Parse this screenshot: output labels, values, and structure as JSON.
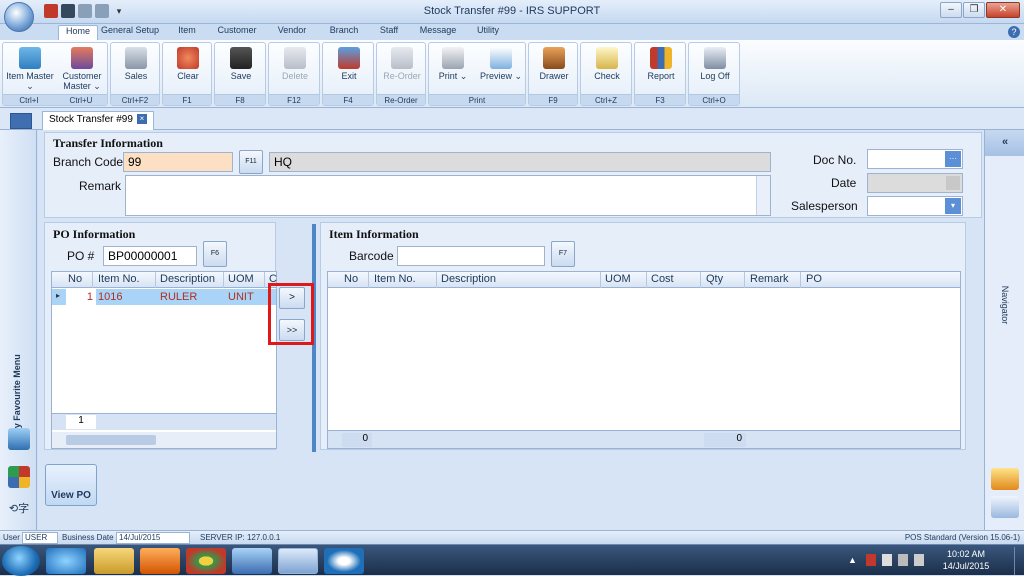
{
  "window": {
    "title": "Stock Transfer #99 - IRS SUPPORT"
  },
  "ribbon_tabs": [
    "Home",
    "General Setup",
    "Item",
    "Customer",
    "Vendor",
    "Branch",
    "Staff",
    "Message",
    "Utility"
  ],
  "ribbon": {
    "item_master": {
      "label": "Item Master",
      "shortcut": "Ctrl+I"
    },
    "customer_master": {
      "label": "Customer Master",
      "shortcut": "Ctrl+U"
    },
    "sales": {
      "label": "Sales",
      "shortcut": "Ctrl+F2"
    },
    "clear": {
      "label": "Clear",
      "shortcut": "F1"
    },
    "save": {
      "label": "Save",
      "shortcut": "F8"
    },
    "delete": {
      "label": "Delete",
      "shortcut": "F12"
    },
    "exit": {
      "label": "Exit",
      "shortcut": "F4"
    },
    "reorder": {
      "label": "Re-Order",
      "shortcut": "Re-Order"
    },
    "print": {
      "label": "Print",
      "shortcut": "Print"
    },
    "preview": {
      "label": "Preview"
    },
    "drawer": {
      "label": "Drawer",
      "shortcut": "F9"
    },
    "check": {
      "label": "Check",
      "shortcut": "Ctrl+Z"
    },
    "report": {
      "label": "Report",
      "shortcut": "F3"
    },
    "logoff": {
      "label": "Log Off",
      "shortcut": "Ctrl+O"
    }
  },
  "doc_tab": "Stock Transfer #99",
  "left_nav": {
    "title": "My Favourite Menu",
    "view_po": "View PO"
  },
  "transfer": {
    "title": "Transfer Information",
    "branch_code_label": "Branch Code",
    "branch_code": "99",
    "branch_btn": "F11",
    "branch_name": "HQ",
    "remark_label": "Remark",
    "doc_no_label": "Doc No.",
    "date_label": "Date",
    "salesperson_label": "Salesperson"
  },
  "po": {
    "title": "PO Information",
    "po_label": "PO #",
    "po_value": "BP00000001",
    "po_btn": "F6",
    "columns": [
      "No",
      "Item No.",
      "Description",
      "UOM",
      "C"
    ],
    "rows": [
      {
        "no": "1",
        "item_no": "1016",
        "description": "RULER",
        "uom": "UNIT"
      }
    ],
    "footer_count": "1"
  },
  "move_buttons": {
    "one": ">",
    "all": ">>"
  },
  "item": {
    "title": "Item Information",
    "barcode_label": "Barcode",
    "barcode_btn": "F7",
    "columns": [
      "No",
      "Item No.",
      "Description",
      "UOM",
      "Cost",
      "Qty",
      "Remark",
      "PO"
    ],
    "footer_count": "0",
    "footer_qty": "0"
  },
  "navigator": {
    "label": "Navigator",
    "collapse": "«"
  },
  "status": {
    "user_label": "User",
    "user": "USER",
    "bdate_label": "Business Date",
    "bdate": "14/Jul/2015",
    "server": "SERVER IP: 127.0.0.1",
    "version": "POS Standard (Version 15.06-1)"
  },
  "taskbar": {
    "time": "10:02 AM",
    "date": "14/Jul/2015"
  }
}
